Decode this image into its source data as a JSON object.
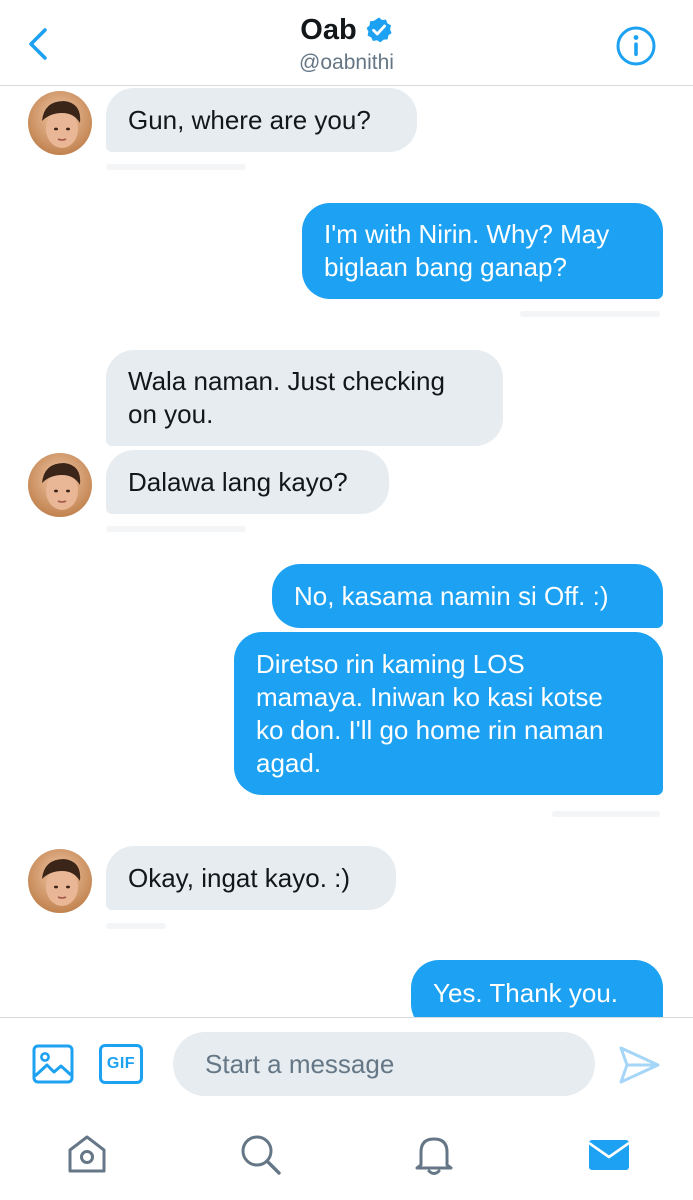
{
  "header": {
    "name": "Oab",
    "handle": "@oabnithi"
  },
  "messages": [
    {
      "from": "them",
      "text": "Gun, where are you?"
    },
    {
      "from": "me",
      "lines": [
        "I'm with Nirin. Why? May",
        "biglaan bang ganap?"
      ]
    },
    {
      "from": "them",
      "lines": [
        "Wala naman. Just checking",
        "on you."
      ]
    },
    {
      "from": "them",
      "text": "Dalawa lang kayo?"
    },
    {
      "from": "me",
      "text": "No, kasama namin si Off. :)"
    },
    {
      "from": "me",
      "lines": [
        "Diretso rin kaming LOS",
        "mamaya. Iniwan ko kasi kotse",
        "ko don. I'll go home rin naman",
        "agad."
      ]
    },
    {
      "from": "them",
      "text": "Okay, ingat kayo. :)"
    },
    {
      "from": "me",
      "text": "Yes. Thank you."
    }
  ],
  "composer": {
    "placeholder": "Start a message",
    "gif_label": "GIF"
  },
  "colors": {
    "accent": "#1da1f2",
    "incoming_bubble": "#e6ecf0",
    "text": "#14171a",
    "muted": "#657786"
  },
  "icons": {
    "back": "chevron-left-icon",
    "verified": "verified-badge-icon",
    "info": "info-icon",
    "media": "image-icon",
    "send": "send-icon",
    "home": "home-icon",
    "search": "search-icon",
    "notifications": "bell-icon",
    "messages": "envelope-icon"
  },
  "tabbar": {
    "active": "messages"
  }
}
